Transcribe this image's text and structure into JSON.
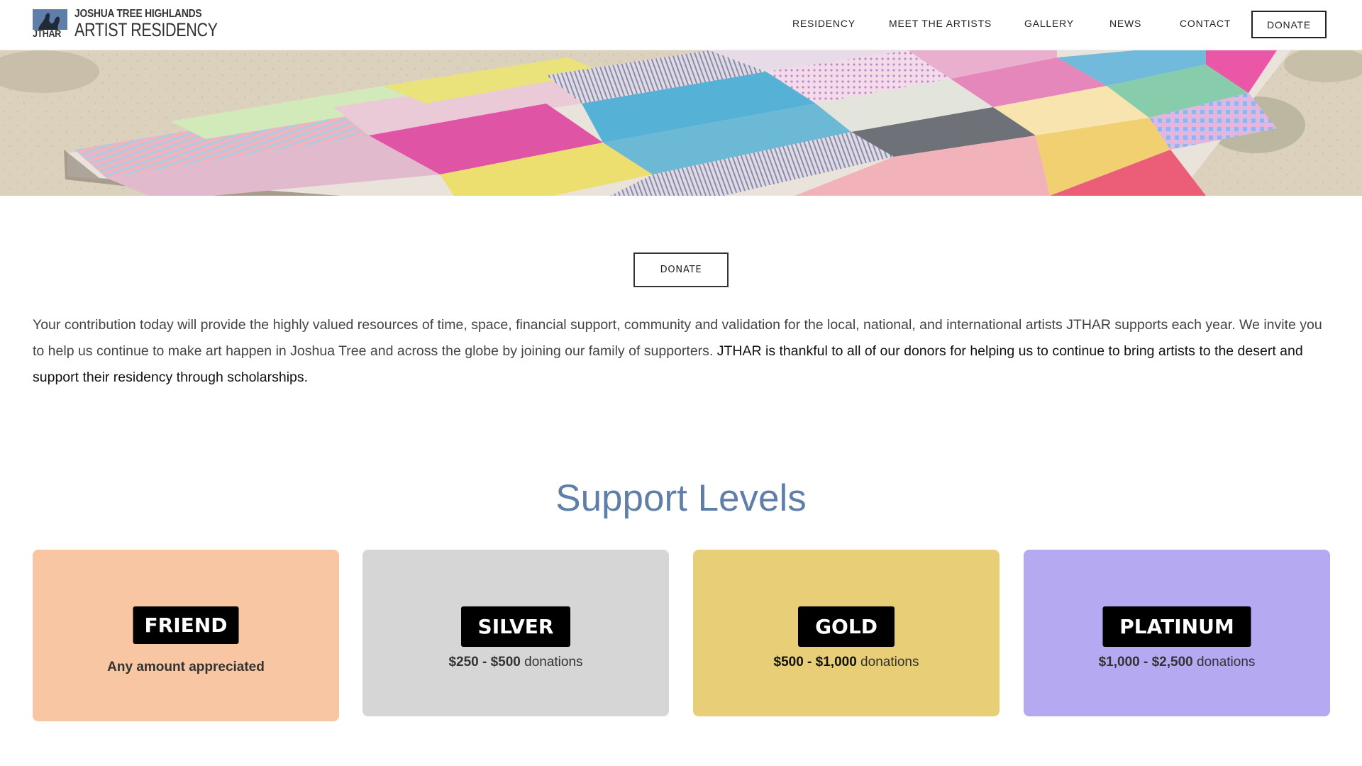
{
  "header": {
    "logo": {
      "mark_text": "JTHAR",
      "line1": "JOSHUA TREE HIGHLANDS",
      "line2": "ARTIST RESIDENCY"
    },
    "nav": {
      "residency": "RESIDENCY",
      "meet_the_artists": "MEET THE ARTISTS",
      "gallery": "GALLERY",
      "news": "NEWS",
      "contact": "CONTACT",
      "donate": "DONATE"
    }
  },
  "main": {
    "donate_button": "DONATE",
    "intro": {
      "text_regular": "Your contribution today will provide the highly valued resources of time, space, financial support, community and validation for the local, national, and international artists JTHAR supports each year. We invite you to help us continue to make art happen in Joshua Tree and across the globe by joining our family of supporters. ",
      "text_emphasis": "JTHAR is thankful to all of our donors for helping us to continue to bring artists to the desert and support their residency through scholarships."
    },
    "support_levels": {
      "title": "Support Levels",
      "levels": [
        {
          "badge": "FRIEND",
          "description": "Any amount appreciated",
          "color": "#f8c6a3"
        },
        {
          "badge": "SILVER",
          "range": "$250 - $500",
          "suffix": " donations",
          "color": "#d6d6d6"
        },
        {
          "badge": "GOLD",
          "range": "$500 - $1,000",
          "suffix": " donations",
          "color": "#e8cf77"
        },
        {
          "badge": "PLATINUM",
          "range": "$1,000 - $2,500",
          "suffix": " donations",
          "color": "#b5a9f2"
        }
      ]
    }
  },
  "colors": {
    "title_blue": "#5f7faa",
    "text": "#444444",
    "badge_bg": "#000000"
  }
}
